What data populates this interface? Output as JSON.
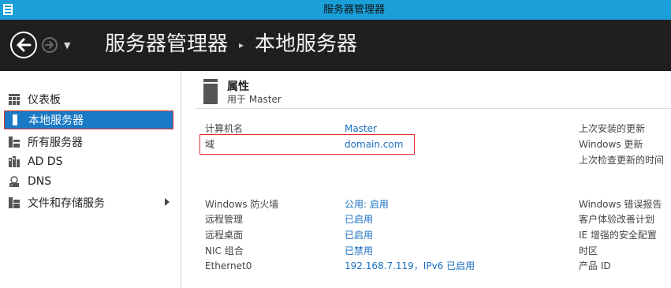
{
  "window": {
    "title": "服务器管理器"
  },
  "header": {
    "breadcrumb": [
      "服务器管理器",
      "本地服务器"
    ],
    "breadcrumb_separator": "▸"
  },
  "sidebar": {
    "items": [
      {
        "label": "仪表板",
        "icon": "dashboard-icon",
        "active": false
      },
      {
        "label": "本地服务器",
        "icon": "local-server-icon",
        "active": true
      },
      {
        "label": "所有服务器",
        "icon": "all-servers-icon",
        "active": false
      },
      {
        "label": "AD DS",
        "icon": "ad-ds-icon",
        "active": false
      },
      {
        "label": "DNS",
        "icon": "dns-icon",
        "active": false
      },
      {
        "label": "文件和存储服务",
        "icon": "file-storage-icon",
        "active": false,
        "has_submenu": true
      }
    ]
  },
  "properties": {
    "title": "属性",
    "subtitle": "用于 Master",
    "rows": [
      {
        "label": "计算机名",
        "value": "Master"
      },
      {
        "label": "域",
        "value": "domain.com"
      },
      {
        "label": "Windows 防火墙",
        "value": "公用: 启用"
      },
      {
        "label": "远程管理",
        "value": "已启用"
      },
      {
        "label": "远程桌面",
        "value": "已启用"
      },
      {
        "label": "NIC 组合",
        "value": "已禁用"
      },
      {
        "label": "Ethernet0",
        "value": "192.168.7.119，IPv6 已启用"
      }
    ],
    "right_labels": [
      "上次安装的更新",
      "Windows 更新",
      "上次检查更新的时间",
      "Windows 错误报告",
      "客户体验改善计划",
      "IE 增强的安全配置",
      "时区",
      "产品 ID"
    ]
  },
  "colors": {
    "titlebar": "#1a9fd9",
    "header": "#1f1f1f",
    "accent": "#1a7ac5",
    "link": "#1a6fc0",
    "highlight": "#e03030"
  }
}
